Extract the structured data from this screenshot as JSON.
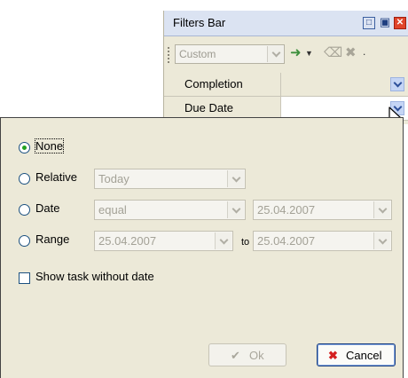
{
  "filters_bar": {
    "title": "Filters Bar",
    "title_buttons": [
      "restore-icon",
      "pin-icon",
      "close-icon"
    ],
    "preset_value": "Custom",
    "toolbar_icons": [
      "apply-filter-icon",
      "eraser-icon",
      "delete-icon",
      "more-icon"
    ],
    "rows": [
      {
        "label": "Completion",
        "value": ""
      },
      {
        "label": "Due Date",
        "value": ""
      }
    ]
  },
  "popup": {
    "options": {
      "none": "None",
      "relative": "Relative",
      "date": "Date",
      "range": "Range"
    },
    "selected": "None",
    "relative_value": "Today",
    "date_operator": "equal",
    "date_value": "25.04.2007",
    "range_from": "25.04.2007",
    "range_to_label": "to",
    "range_to": "25.04.2007",
    "show_without_date_label": "Show task without date",
    "show_without_date_checked": false,
    "ok_label": "Ok",
    "cancel_label": "Cancel"
  },
  "colors": {
    "panel_bg": "#ece9d8",
    "title_bg": "#dbe3f2",
    "accent_blue": "#2c4f9a",
    "radio_dot": "#21a121",
    "cancel_icon": "#d42020"
  }
}
